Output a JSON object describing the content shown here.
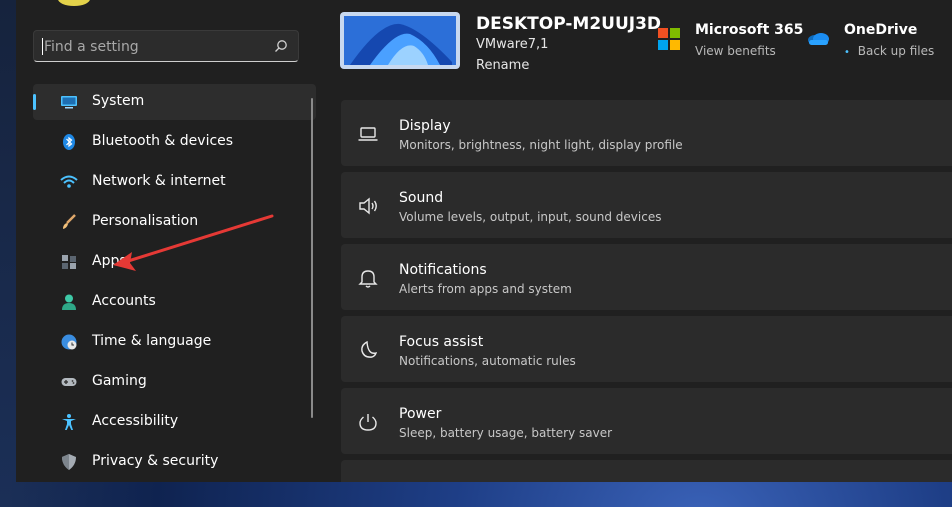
{
  "search": {
    "placeholder": "Find a setting"
  },
  "sidebar": {
    "items": [
      {
        "label": "System",
        "icon": "monitor-icon"
      },
      {
        "label": "Bluetooth & devices",
        "icon": "bluetooth-icon"
      },
      {
        "label": "Network & internet",
        "icon": "wifi-icon"
      },
      {
        "label": "Personalisation",
        "icon": "brush-icon"
      },
      {
        "label": "Apps",
        "icon": "apps-icon"
      },
      {
        "label": "Accounts",
        "icon": "person-icon"
      },
      {
        "label": "Time & language",
        "icon": "globe-clock-icon"
      },
      {
        "label": "Gaming",
        "icon": "gamepad-icon"
      },
      {
        "label": "Accessibility",
        "icon": "accessibility-icon"
      },
      {
        "label": "Privacy & security",
        "icon": "shield-icon"
      }
    ]
  },
  "header": {
    "device_name": "DESKTOP-M2UUJ3D",
    "device_model": "VMware7,1",
    "rename_label": "Rename",
    "microsoft365": {
      "title": "Microsoft 365",
      "subtitle": "View benefits"
    },
    "onedrive": {
      "title": "OneDrive",
      "subtitle": "Back up files"
    }
  },
  "cards": [
    {
      "title": "Display",
      "desc": "Monitors, brightness, night light, display profile",
      "icon": "laptop-icon"
    },
    {
      "title": "Sound",
      "desc": "Volume levels, output, input, sound devices",
      "icon": "speaker-icon"
    },
    {
      "title": "Notifications",
      "desc": "Alerts from apps and system",
      "icon": "bell-icon"
    },
    {
      "title": "Focus assist",
      "desc": "Notifications, automatic rules",
      "icon": "moon-icon"
    },
    {
      "title": "Power",
      "desc": "Sleep, battery usage, battery saver",
      "icon": "power-icon"
    }
  ],
  "colors": {
    "accent": "#4cc2ff",
    "annotation_arrow": "#e53935"
  }
}
